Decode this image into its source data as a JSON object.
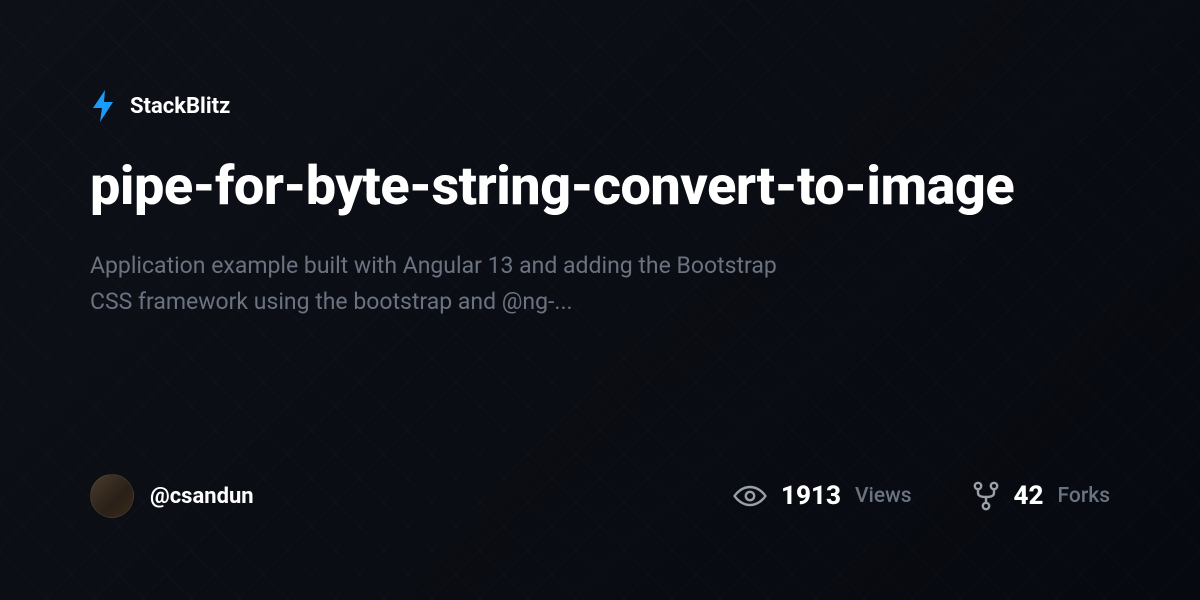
{
  "brand": {
    "name": "StackBlitz"
  },
  "project": {
    "title": "pipe-for-byte-string-convert-to-image",
    "description": "Application example built with Angular 13 and adding the Bootstrap CSS framework using the bootstrap and @ng-..."
  },
  "author": {
    "handle": "@csandun"
  },
  "stats": {
    "views": {
      "value": "1913",
      "label": "Views"
    },
    "forks": {
      "value": "42",
      "label": "Forks"
    }
  },
  "colors": {
    "accent": "#1b9cfc"
  }
}
